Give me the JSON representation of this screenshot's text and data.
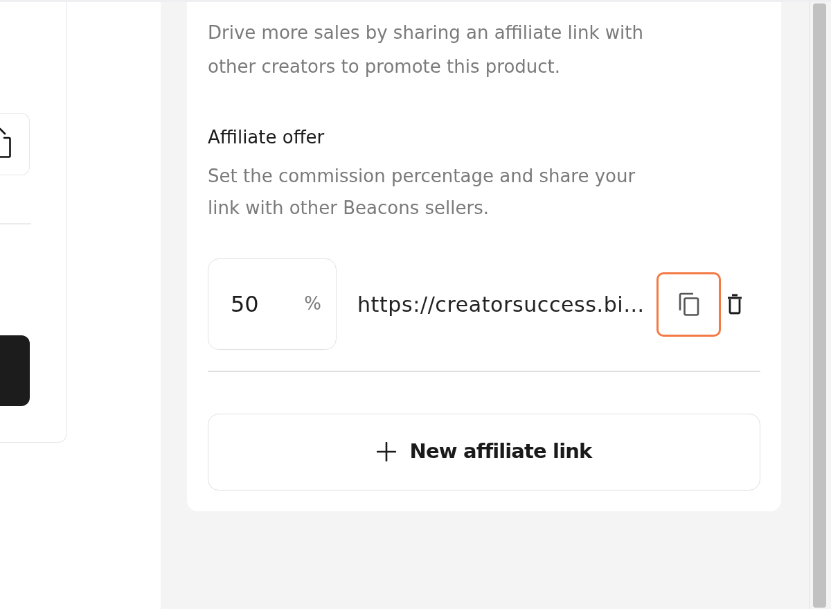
{
  "affiliate_panel": {
    "description": "Drive more sales by sharing an affiliate link with other creators to promote this product.",
    "offer": {
      "title": "Affiliate offer",
      "description": "Set the commission percentage and share your link with other Beacons sellers."
    },
    "links": [
      {
        "commission": "50",
        "unit": "%",
        "url": "https://creatorsuccess.bi…",
        "copy_highlighted": true
      }
    ],
    "new_link_button": "New affiliate link"
  }
}
